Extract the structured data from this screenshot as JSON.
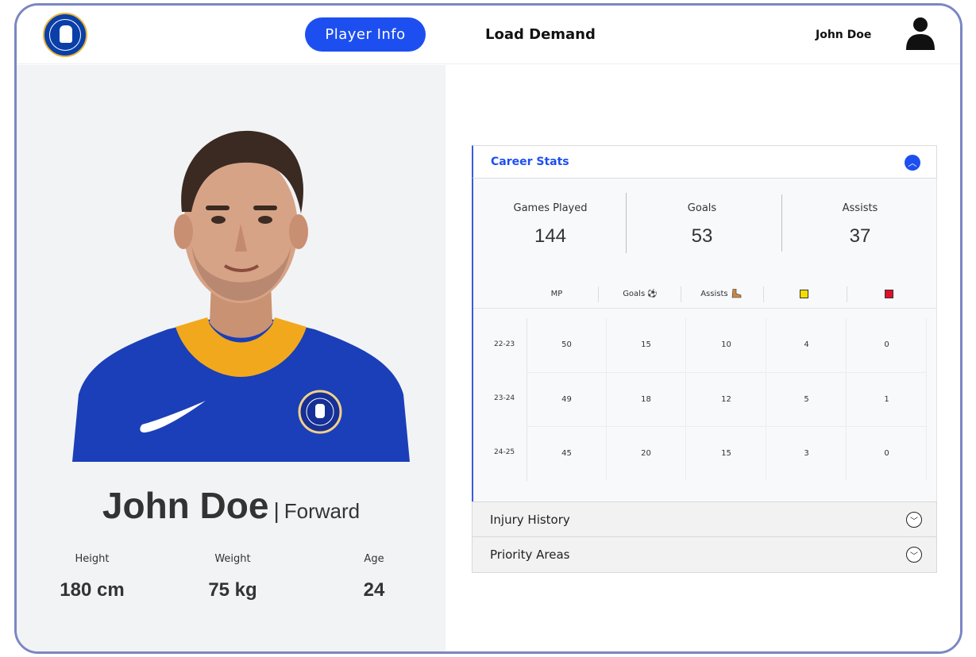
{
  "header": {
    "logo_name": "chelsea-crest",
    "nav": {
      "active_label": "Player Info",
      "second_label": "Load Demand"
    },
    "user": {
      "name": "John Doe",
      "icon": "user-icon"
    }
  },
  "player": {
    "name": "John Doe",
    "separator": "|",
    "position": "Forward",
    "attributes": [
      {
        "label": "Height",
        "value": "180 cm"
      },
      {
        "label": "Weight",
        "value": "75 kg"
      },
      {
        "label": "Age",
        "value": "24"
      }
    ]
  },
  "career": {
    "title": "Career Stats",
    "summary": [
      {
        "label": "Games Played",
        "value": "144"
      },
      {
        "label": "Goals",
        "value": "53"
      },
      {
        "label": "Assists",
        "value": "37"
      }
    ],
    "columns": [
      "MP",
      "Goals",
      "Assists"
    ],
    "column_icons": {
      "goals": "football-icon",
      "assists": "boot-icon",
      "yellow": "yellow-card-icon",
      "red": "red-card-icon"
    },
    "rows": [
      {
        "season": "22-23",
        "values": [
          "50",
          "15",
          "10",
          "4",
          "0"
        ]
      },
      {
        "season": "23-24",
        "values": [
          "49",
          "18",
          "12",
          "5",
          "1"
        ]
      },
      {
        "season": "24-25",
        "values": [
          "45",
          "20",
          "15",
          "3",
          "0"
        ]
      }
    ]
  },
  "accordions": [
    {
      "label": "Injury History"
    },
    {
      "label": "Priority Areas"
    }
  ],
  "colors": {
    "accent": "#1d4ff0",
    "frame": "#7b86c2",
    "yellow_card": "#f5dc00",
    "red_card": "#e0102a",
    "kit_blue": "#1a3fb8"
  }
}
